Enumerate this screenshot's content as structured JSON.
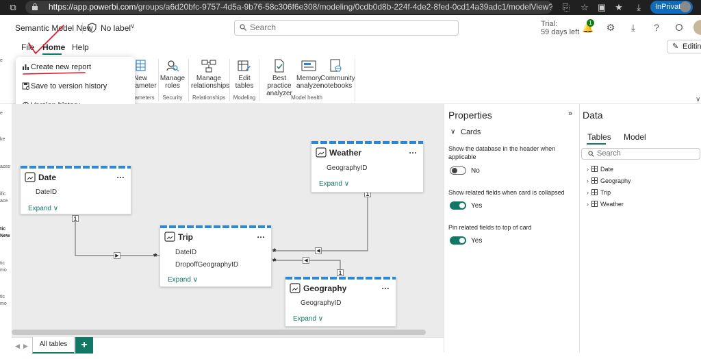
{
  "browser": {
    "url_host": "https://app.powerbi.com",
    "url_path": "/groups/a6d20bfc-9757-4d5a-9b76-58c306f6e308/modeling/0cdb0d8b-224f-4de2-8fed-0cd14a39adc1/modelView?webModelingEditMo...",
    "inprivate_label": "InPrivate"
  },
  "header": {
    "model_title": "Semantic Model New",
    "label_text": "No label",
    "search_placeholder": "Search",
    "trial_line1": "Trial:",
    "trial_line2": "59 days left",
    "notification_count": "1"
  },
  "ribbon": {
    "tabs": {
      "file": "File",
      "home": "Home",
      "help": "Help"
    },
    "editing_label": "Editing",
    "buttons": {
      "new_parameter_1": "New",
      "new_parameter_2": "parameter",
      "manage_roles_1": "Manage",
      "manage_roles_2": "roles",
      "manage_rel_1": "Manage",
      "manage_rel_2": "relationships",
      "edit_tables_1": "Edit",
      "edit_tables_2": "tables",
      "best_practice_1": "Best practice",
      "best_practice_2": "analyzer",
      "memory_1": "Memory",
      "memory_2": "analyzer",
      "community_1": "Community",
      "community_2": "notebooks"
    },
    "groups": {
      "parameters": "Parameters",
      "security": "Security",
      "relationships": "Relationships",
      "modeling": "Modeling",
      "model_health": "Model health"
    }
  },
  "file_menu": {
    "items": [
      {
        "label": "Create new report",
        "icon": "chart-icon"
      },
      {
        "label": "Save to version history",
        "icon": "save-icon"
      },
      {
        "label": "Version history",
        "icon": "history-icon"
      }
    ]
  },
  "left_strip": {
    "snippets": [
      "e",
      "e",
      "ke",
      "aces",
      "ific",
      "ace",
      "tic",
      "New",
      "tic",
      "mo",
      "tic",
      "mo"
    ]
  },
  "canvas": {
    "tables": {
      "weather": {
        "title": "Weather",
        "fields": [
          "GeographyID"
        ],
        "expand": "Expand"
      },
      "date": {
        "title": "Date",
        "fields": [
          "DateID"
        ],
        "expand": "Expand"
      },
      "trip": {
        "title": "Trip",
        "fields": [
          "DateID",
          "DropoffGeographyID"
        ],
        "expand": "Expand"
      },
      "geography": {
        "title": "Geography",
        "fields": [
          "GeographyID"
        ],
        "expand": "Expand"
      }
    },
    "cardinality": {
      "one": "1",
      "many": "*"
    }
  },
  "properties": {
    "title": "Properties",
    "section": "Cards",
    "options": [
      {
        "label": "Show the database in the header when applicable",
        "state": "No",
        "on": false
      },
      {
        "label": "Show related fields when card is collapsed",
        "state": "Yes",
        "on": true
      },
      {
        "label": "Pin related fields to top of card",
        "state": "Yes",
        "on": true
      }
    ]
  },
  "data_pane": {
    "title": "Data",
    "tabs": [
      "Tables",
      "Model"
    ],
    "search_placeholder": "Search",
    "tables": [
      "Date",
      "Geography",
      "Trip",
      "Weather"
    ]
  },
  "bottom_tabs": {
    "all_tables": "All tables",
    "add": "+"
  },
  "colors": {
    "accent": "#117865",
    "card_stripe": "#2b88d8",
    "annotation": "#e81123"
  }
}
